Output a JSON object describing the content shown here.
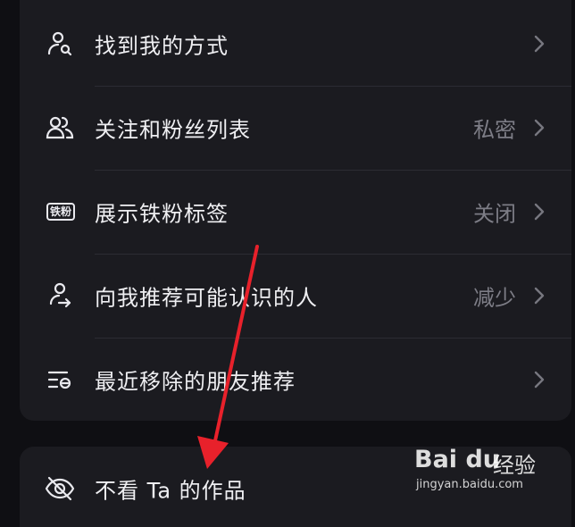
{
  "settings": {
    "items": [
      {
        "label": "找到我的方式",
        "value": "",
        "icon": "person-search-icon"
      },
      {
        "label": "关注和粉丝列表",
        "value": "私密",
        "icon": "people-icon"
      },
      {
        "label": "展示铁粉标签",
        "value": "关闭",
        "icon": "fan-badge-icon",
        "badge_text": "铁粉"
      },
      {
        "label": "向我推荐可能认识的人",
        "value": "减少",
        "icon": "person-recommend-icon"
      },
      {
        "label": "最近移除的朋友推荐",
        "value": "",
        "icon": "list-removed-icon"
      }
    ],
    "second_card_item": {
      "label": "不看 Ta 的作品",
      "icon": "eye-hidden-icon"
    }
  },
  "watermark": {
    "logo": "Bai du",
    "brand_cn": "经验",
    "url": "jingyan.baidu.com"
  },
  "colors": {
    "background": "#0f0f13",
    "card": "#1b1b20",
    "text_primary": "#efeff2",
    "text_secondary": "#7d7d86",
    "annotation_arrow": "#e8212b"
  }
}
